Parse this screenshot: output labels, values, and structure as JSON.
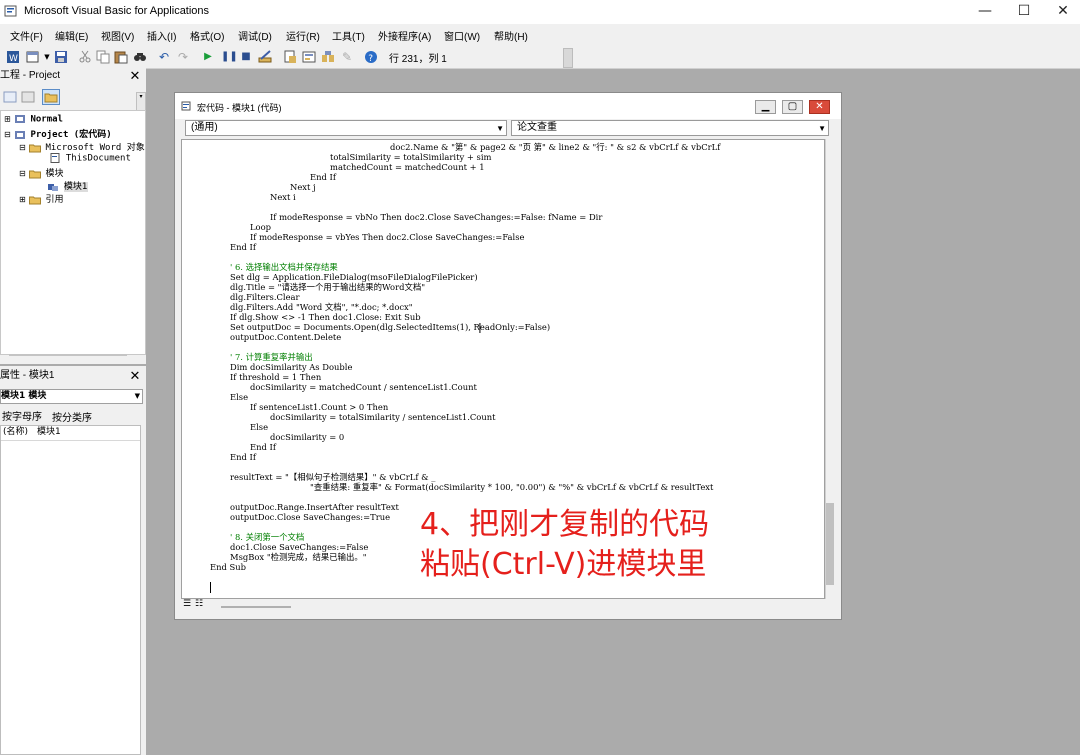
{
  "window": {
    "title": "Microsoft Visual Basic for Applications",
    "min_glyph": "—",
    "max_glyph": "☐",
    "close_glyph": "✕"
  },
  "menu": [
    "文件(F)",
    "编辑(E)",
    "视图(V)",
    "插入(I)",
    "格式(O)",
    "调试(D)",
    "运行(R)",
    "工具(T)",
    "外接程序(A)",
    "窗口(W)",
    "帮助(H)"
  ],
  "toolbar": {
    "cursor_position": "行 231，列 1"
  },
  "project": {
    "title": "工程 - Project",
    "tree": [
      {
        "label": "Normal",
        "level": 0
      },
      {
        "label": "Project (宏代码)",
        "level": 0
      },
      {
        "label": "Microsoft Word 对象",
        "level": 1
      },
      {
        "label": "ThisDocument",
        "level": 2
      },
      {
        "label": "模块",
        "level": 1
      },
      {
        "label": "模块1",
        "level": 2
      },
      {
        "label": "引用",
        "level": 1
      }
    ]
  },
  "properties": {
    "title": "属性 - 模块1",
    "object_select": "模块1 模块",
    "tabs": [
      "按字母序",
      "按分类序"
    ],
    "rows": [
      {
        "name": "(名称)",
        "value": "模块1"
      }
    ]
  },
  "code_window": {
    "title": "宏代码 - 模块1 (代码)",
    "object_combo": "(通用)",
    "proc_combo": "论文查重",
    "lines": [
      {
        "indent": 32,
        "text": "doc2.Name & \"第\" & page2 & \"页 第\" & line2 & \"行: \" & s2 & vbCrLf & vbCrLf",
        "comment": false
      },
      {
        "indent": 20,
        "text": "totalSimilarity = totalSimilarity + sim",
        "comment": false
      },
      {
        "indent": 20,
        "text": "matchedCount = matchedCount + 1",
        "comment": false
      },
      {
        "indent": 16,
        "text": "End If",
        "comment": false
      },
      {
        "indent": 12,
        "text": "Next j",
        "comment": false
      },
      {
        "indent": 8,
        "text": "Next i",
        "comment": false
      },
      {
        "indent": 0,
        "text": "",
        "comment": false
      },
      {
        "indent": 8,
        "text": "If modeResponse = vbNo Then doc2.Close SaveChanges:=False: fName = Dir",
        "comment": false
      },
      {
        "indent": 4,
        "text": "Loop",
        "comment": false
      },
      {
        "indent": 4,
        "text": "If modeResponse = vbYes Then doc2.Close SaveChanges:=False",
        "comment": false
      },
      {
        "indent": 0,
        "text": "End If",
        "comment": false
      },
      {
        "indent": 0,
        "text": "",
        "comment": false
      },
      {
        "indent": 0,
        "text": "' 6. 选择输出文档并保存结果",
        "comment": true
      },
      {
        "indent": 0,
        "text": "Set dlg = Application.FileDialog(msoFileDialogFilePicker)",
        "comment": false
      },
      {
        "indent": 0,
        "text": "dlg.Title = \"请选择一个用于输出结果的Word文档\"",
        "comment": false
      },
      {
        "indent": 0,
        "text": "dlg.Filters.Clear",
        "comment": false
      },
      {
        "indent": 0,
        "text": "dlg.Filters.Add \"Word 文档\", \"*.doc; *.docx\"",
        "comment": false
      },
      {
        "indent": 0,
        "text": "If dlg.Show <> -1 Then doc1.Close: Exit Sub",
        "comment": false
      },
      {
        "indent": 0,
        "text": "Set outputDoc = Documents.Open(dlg.SelectedItems(1), ReadOnly:=False)",
        "comment": false
      },
      {
        "indent": 0,
        "text": "outputDoc.Content.Delete",
        "comment": false
      },
      {
        "indent": 0,
        "text": "",
        "comment": false
      },
      {
        "indent": 0,
        "text": "' 7. 计算重复率并输出",
        "comment": true
      },
      {
        "indent": 0,
        "text": "Dim docSimilarity As Double",
        "comment": false
      },
      {
        "indent": 0,
        "text": "If threshold = 1 Then",
        "comment": false
      },
      {
        "indent": 4,
        "text": "docSimilarity = matchedCount / sentenceList1.Count",
        "comment": false
      },
      {
        "indent": 0,
        "text": "Else",
        "comment": false
      },
      {
        "indent": 4,
        "text": "If sentenceList1.Count > 0 Then",
        "comment": false
      },
      {
        "indent": 8,
        "text": "docSimilarity = totalSimilarity / sentenceList1.Count",
        "comment": false
      },
      {
        "indent": 4,
        "text": "Else",
        "comment": false
      },
      {
        "indent": 8,
        "text": "docSimilarity = 0",
        "comment": false
      },
      {
        "indent": 4,
        "text": "End If",
        "comment": false
      },
      {
        "indent": 0,
        "text": "End If",
        "comment": false
      },
      {
        "indent": 0,
        "text": "",
        "comment": false
      },
      {
        "indent": 0,
        "text": "resultText = \"【相似句子检测结果】\" & vbCrLf & _",
        "comment": false
      },
      {
        "indent": 16,
        "text": "\"查重结果: 重复率\" & Format(docSimilarity * 100, \"0.00\") & \"%\" & vbCrLf & vbCrLf & resultText",
        "comment": false
      },
      {
        "indent": 0,
        "text": "",
        "comment": false
      },
      {
        "indent": 0,
        "text": "outputDoc.Range.InsertAfter resultText",
        "comment": false
      },
      {
        "indent": 0,
        "text": "outputDoc.Close SaveChanges:=True",
        "comment": false
      },
      {
        "indent": 0,
        "text": "",
        "comment": false
      },
      {
        "indent": 0,
        "text": "' 8. 关闭第一个文档",
        "comment": true
      },
      {
        "indent": 0,
        "text": "doc1.Close SaveChanges:=False",
        "comment": false
      },
      {
        "indent": 0,
        "text": "MsgBox \"检测完成，结果已输出。\"",
        "comment": false
      },
      {
        "indent": -4,
        "text": "End Sub",
        "comment": false
      }
    ]
  },
  "overlay": {
    "line1": "4、把刚才复制的代码",
    "line2": "粘贴(Ctrl-V)进模块里",
    "color": "#e5201c"
  }
}
